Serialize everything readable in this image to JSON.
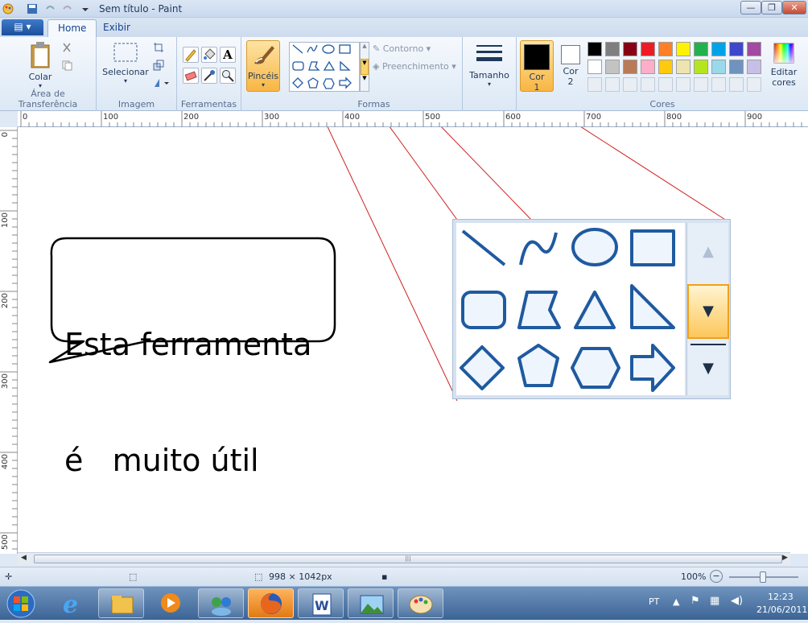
{
  "window": {
    "title": "Sem título - Paint",
    "buttons": [
      "—",
      "❐",
      "✕"
    ]
  },
  "tabs": [
    {
      "label": "Home",
      "active": true
    },
    {
      "label": "Exibir",
      "active": false
    }
  ],
  "groups": {
    "clipboard": {
      "label": "Área de Transferência",
      "paste": "Colar"
    },
    "image": {
      "label": "Imagem",
      "select": "Selecionar"
    },
    "tools": {
      "label": "Ferramentas"
    },
    "brushes": {
      "label": "Pincéis"
    },
    "shapes": {
      "label": "Formas",
      "outline": "Contorno",
      "fill": "Preenchimento"
    },
    "size": {
      "label": "Tamanho"
    },
    "colors": {
      "label": "Cores",
      "color1": "Cor",
      "color1_num": "1",
      "color2": "Cor",
      "color2_num": "2",
      "edit": "Editar",
      "edit2": "cores",
      "color1_value": "#000000",
      "color2_value": "#ffffff",
      "row1": [
        "#000000",
        "#7f7f7f",
        "#880015",
        "#ed1c24",
        "#ff7f27",
        "#fff200",
        "#22b14c",
        "#00a2e8",
        "#3f48cc",
        "#a349a4"
      ],
      "row2": [
        "#ffffff",
        "#c3c3c3",
        "#b97a57",
        "#ffaec9",
        "#ffc90e",
        "#efe4b0",
        "#b5e61d",
        "#99d9ea",
        "#7092be",
        "#c8bfe7"
      ]
    }
  },
  "ruler": {
    "h": [
      "0",
      "100",
      "200",
      "300",
      "400",
      "500",
      "600",
      "700",
      "800",
      "900"
    ],
    "v": [
      "0",
      "100",
      "200",
      "300",
      "400",
      "500"
    ]
  },
  "callout": {
    "line1": "Esta ferramenta",
    "line2": "é   muito útil"
  },
  "status": {
    "dimensions": "998 × 1042px",
    "zoom": "100%"
  },
  "tray": {
    "lang": "PT",
    "time": "12:23",
    "date": "21/06/2011"
  }
}
